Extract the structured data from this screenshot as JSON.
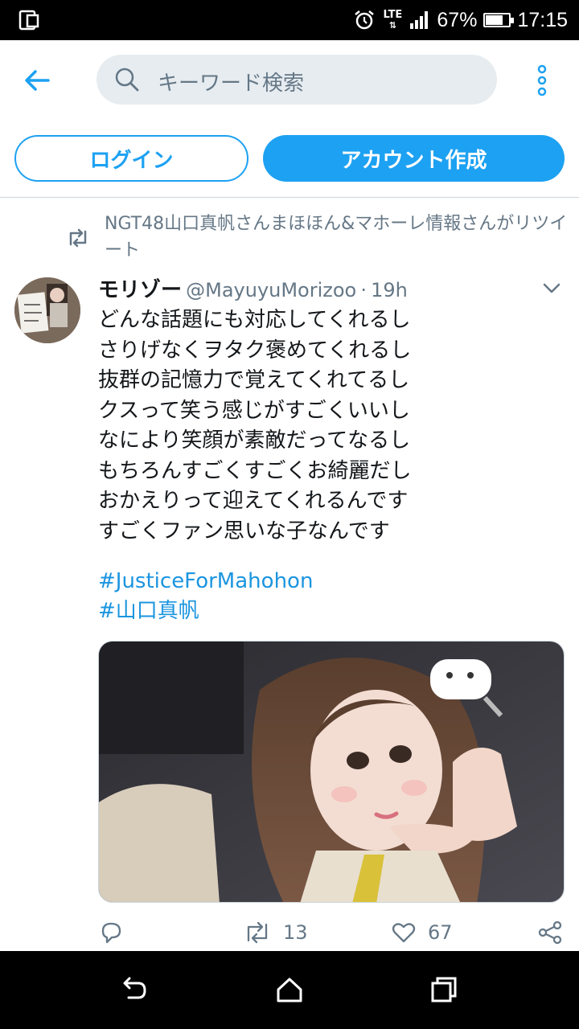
{
  "status_bar": {
    "network": "LTE",
    "battery_percent": "67%",
    "battery_level": 0.67,
    "time": "17:15"
  },
  "header": {
    "search_placeholder": "キーワード検索"
  },
  "auth": {
    "login_label": "ログイン",
    "signup_label": "アカウント作成"
  },
  "retweet_context": {
    "text": "NGT48山口真帆さんまほほん&マホーレ情報さんがリツイート"
  },
  "tweet": {
    "display_name": "モリゾー",
    "handle": "@MayuyuMorizoo",
    "separator": "·",
    "time": "19h",
    "lines": [
      "どんな話題にも対応してくれるし",
      "さりげなくヲタク褒めてくれるし",
      "抜群の記憶力で覚えてくれてるし",
      "クスって笑う感じがすごくいいし",
      "なにより笑顔が素敵だってなるし",
      "もちろんすごくすごくお綺麗だし",
      "おかえりって迎えてくれるんです",
      "すごくファン思いな子なんです"
    ],
    "hashtags": [
      "#JusticeForMahohon",
      "#山口真帆"
    ],
    "retweet_count": "13",
    "like_count": "67"
  },
  "icons": {
    "back": "back-arrow-icon",
    "search": "search-icon",
    "more": "more-vertical-icon",
    "retweet": "retweet-icon",
    "caret": "chevron-down-icon",
    "reply": "reply-icon",
    "like": "heart-icon",
    "share": "share-icon"
  },
  "colors": {
    "accent": "#1da1f2",
    "secondary_text": "#657786",
    "hashtag": "#1b95e0"
  }
}
